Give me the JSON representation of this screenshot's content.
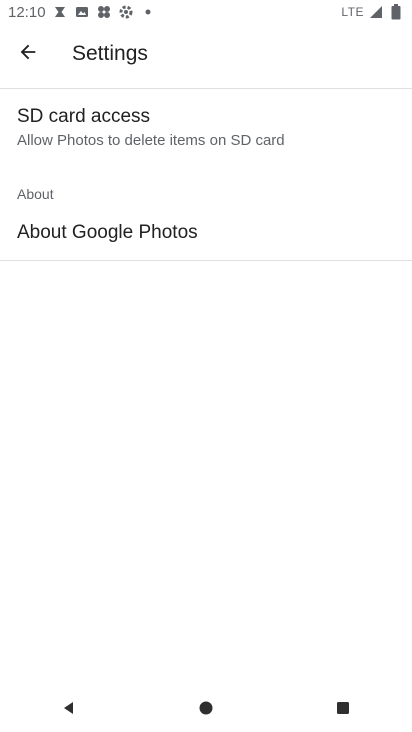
{
  "status_bar": {
    "time": "12:10",
    "network": "LTE",
    "icons": [
      "gmail-x-icon",
      "photos-icon",
      "pinwheel-icon",
      "settings-icon",
      "dot-icon"
    ]
  },
  "app_bar": {
    "title": "Settings",
    "back_icon": "arrow-back-icon"
  },
  "preferences": {
    "sd_card": {
      "title": "SD card access",
      "summary": "Allow Photos to delete items on SD card"
    },
    "about_header": "About",
    "about_item": {
      "title": "About Google Photos"
    }
  },
  "nav_bar": {
    "buttons": [
      "back-triangle-icon",
      "home-circle-icon",
      "recents-square-icon"
    ]
  },
  "colors": {
    "text_primary": "#212121",
    "text_secondary": "#5f6368",
    "divider": "#e0e0e0",
    "background": "#ffffff"
  }
}
